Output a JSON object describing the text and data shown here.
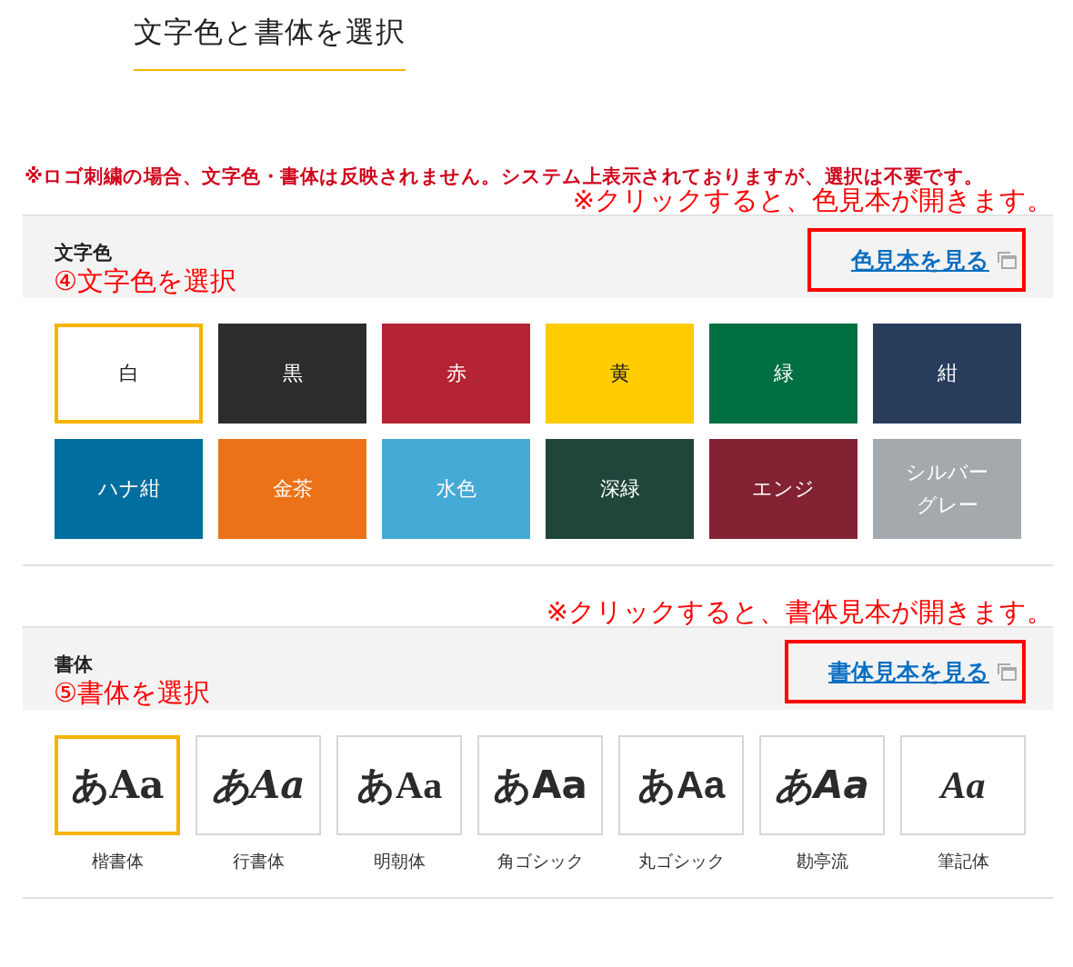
{
  "heading": "文字色と書体を選択",
  "notice": "※ロゴ刺繍の場合、文字色・書体は反映されません。システム上表示されておりますが、選択は不要です。",
  "color_section": {
    "annotation": "※クリックすると、色見本が開きます。",
    "title": "文字色",
    "link": "色見本を見る",
    "step": "④文字色を選択",
    "swatches": [
      {
        "label": "白",
        "color": "#ffffff",
        "selected": true
      },
      {
        "label": "黒",
        "color": "#2d2d2d",
        "selected": false
      },
      {
        "label": "赤",
        "color": "#b42434",
        "selected": false
      },
      {
        "label": "黄",
        "color": "#ffcc00",
        "selected": false
      },
      {
        "label": "緑",
        "color": "#006f42",
        "selected": false
      },
      {
        "label": "紺",
        "color": "#283c5c",
        "selected": false
      },
      {
        "label": "ハナ紺",
        "color": "#016ea0",
        "selected": false
      },
      {
        "label": "金茶",
        "color": "#ec7219",
        "selected": false
      },
      {
        "label": "水色",
        "color": "#45aad5",
        "selected": false
      },
      {
        "label": "深緑",
        "color": "#20463c",
        "selected": false
      },
      {
        "label": "エンジ",
        "color": "#832232",
        "selected": false
      },
      {
        "label": "シルバーグレー",
        "color": "#a4a9ae",
        "selected": false
      }
    ]
  },
  "font_section": {
    "annotation": "※クリックすると、書体見本が開きます。",
    "title": "書体",
    "link": "書体見本を見る",
    "step": "⑤書体を選択",
    "fonts": [
      {
        "label": "楷書体",
        "sample": "あAa",
        "kind": "brush",
        "selected": true
      },
      {
        "label": "行書体",
        "sample": "あAa",
        "kind": "cursive",
        "selected": false
      },
      {
        "label": "明朝体",
        "sample": "あAa",
        "kind": "serif",
        "selected": false
      },
      {
        "label": "角ゴシック",
        "sample": "あAa",
        "kind": "gothic",
        "selected": false
      },
      {
        "label": "丸ゴシック",
        "sample": "あAa",
        "kind": "rounded",
        "selected": false
      },
      {
        "label": "勘亭流",
        "sample": "あAa",
        "kind": "kantei",
        "selected": false
      },
      {
        "label": "筆記体",
        "sample": "Aa",
        "kind": "script",
        "selected": false
      }
    ]
  }
}
